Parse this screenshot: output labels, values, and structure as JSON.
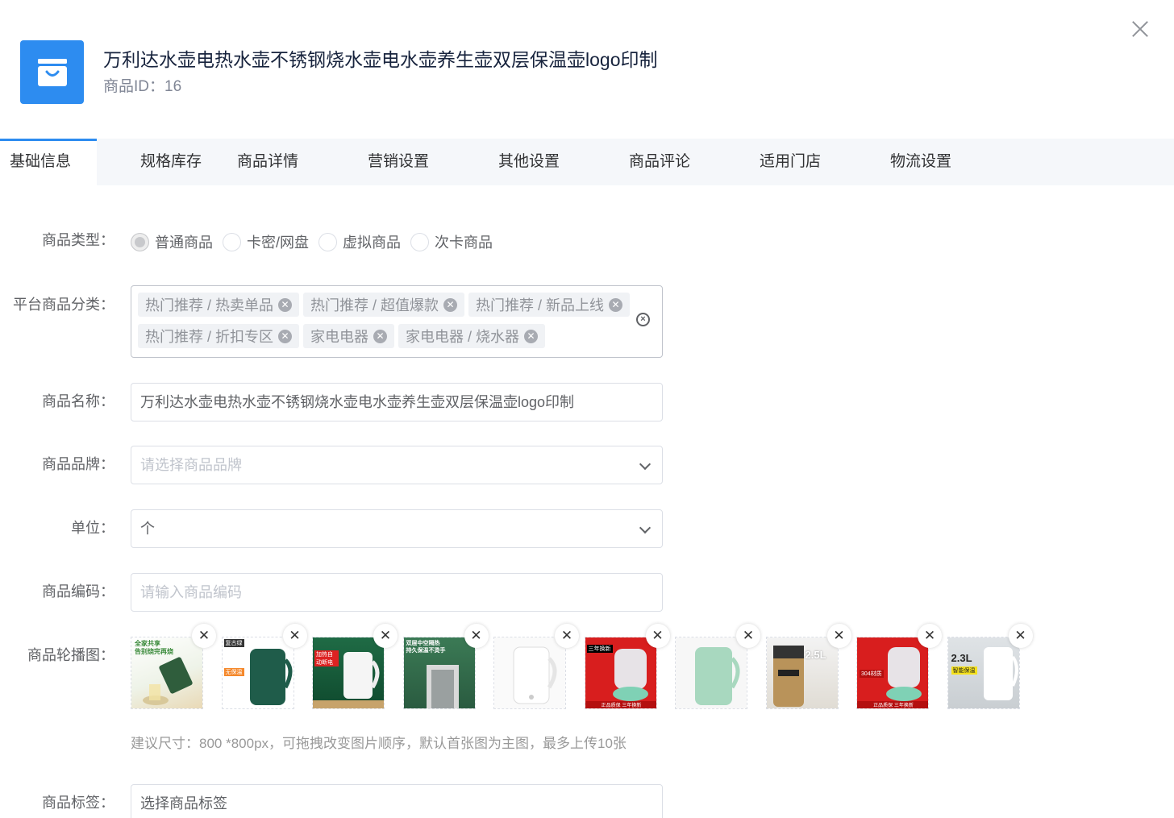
{
  "product": {
    "title": "万利达水壶电热水壶不锈钢烧水壶电水壶养生壶双层保温壶logo印制",
    "id_label": "商品ID：16"
  },
  "tabs": [
    "基础信息",
    "规格库存",
    "商品详情",
    "营销设置",
    "其他设置",
    "商品评论",
    "适用门店",
    "物流设置"
  ],
  "form": {
    "type": {
      "label": "商品类型：",
      "options": [
        "普通商品",
        "卡密/网盘",
        "虚拟商品",
        "次卡商品"
      ],
      "selected": "普通商品"
    },
    "category": {
      "label": "平台商品分类：",
      "tags": [
        "热门推荐 / 热卖单品",
        "热门推荐 / 超值爆款",
        "热门推荐 / 新品上线",
        "热门推荐 / 折扣专区",
        "家电电器",
        "家电电器 / 烧水器"
      ]
    },
    "name": {
      "label": "商品名称：",
      "value": "万利达水壶电热水壶不锈钢烧水壶电水壶养生壶双层保温壶logo印制"
    },
    "brand": {
      "label": "商品品牌：",
      "placeholder": "请选择商品品牌"
    },
    "unit": {
      "label": "单位：",
      "value": "个"
    },
    "code": {
      "label": "商品编码：",
      "placeholder": "请输入商品编码"
    },
    "gallery": {
      "label": "商品轮播图：",
      "images": [
        {
          "name": "product-image-1",
          "text1": "全家共享",
          "text2": "告别烧完再烧"
        },
        {
          "name": "product-image-2",
          "text1": "复古绿",
          "text2": "无保温"
        },
        {
          "name": "product-image-3",
          "text1": "加热自动断电",
          "text2": ""
        },
        {
          "name": "product-image-4",
          "text1": "双层中空隔热",
          "text2": "持久保温不烫手"
        },
        {
          "name": "product-image-5",
          "text1": "",
          "text2": ""
        },
        {
          "name": "product-image-6",
          "text1": "三年换新",
          "text2": "正品质保 三年换新"
        },
        {
          "name": "product-image-7",
          "text1": "",
          "text2": ""
        },
        {
          "name": "product-image-8",
          "text1": "2.5L",
          "text2": ""
        },
        {
          "name": "product-image-9",
          "text1": "304材质",
          "text2": "正品质保 三年换新"
        },
        {
          "name": "product-image-10",
          "text1": "2.3L",
          "text2": "智能保温"
        }
      ],
      "hint": "建议尺寸：800 *800px，可拖拽改变图片顺序，默认首张图为主图，最多上传10张"
    },
    "tag_field": {
      "label": "商品标签：",
      "value": "选择商品标签"
    }
  },
  "colors": {
    "primary": "#2d8cf0"
  }
}
